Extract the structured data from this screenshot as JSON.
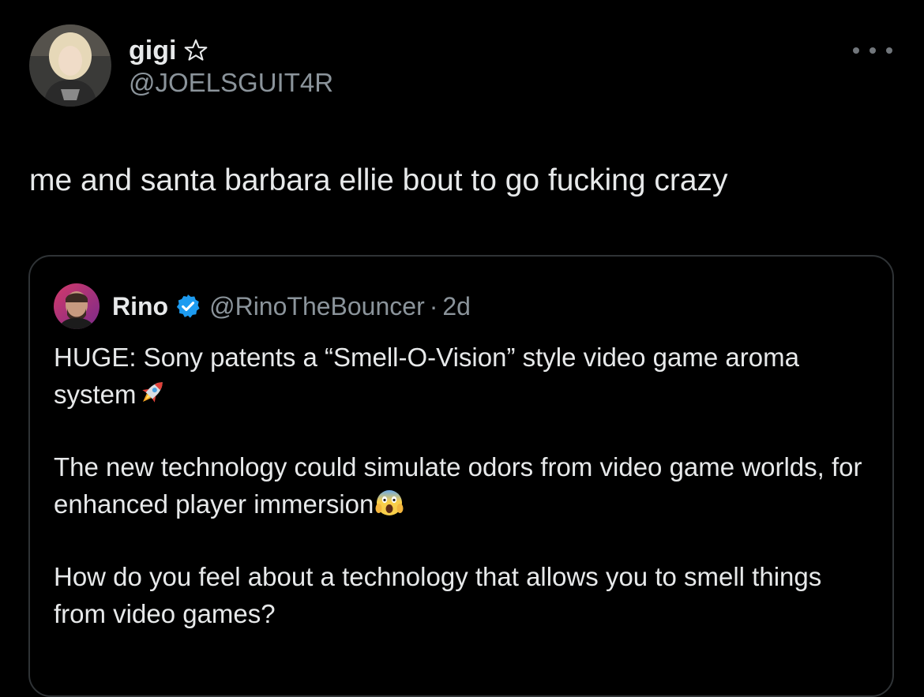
{
  "tweet": {
    "author": {
      "display_name": "gigi",
      "handle": "@JOELSGUIT4R",
      "badge_icon": "star-outline-icon"
    },
    "text": "me and santa barbara ellie bout to go fucking crazy",
    "more_icon": "more-horizontal-icon"
  },
  "quote": {
    "author": {
      "display_name": "Rino",
      "verified_icon": "verified-badge-icon",
      "handle": "@RinoTheBouncer",
      "separator": "·",
      "time": "2d"
    },
    "paragraphs": [
      {
        "text": "HUGE: Sony patents a “Smell-O-Vision” style video game aroma system",
        "emoji": "rocket-emoji"
      },
      {
        "text": "The new technology could simulate odors from video game worlds, for enhanced player immersion",
        "emoji": "screaming-face-emoji"
      },
      {
        "text": "How do you feel about a technology that allows you to smell things from video games?",
        "emoji": ""
      }
    ]
  },
  "colors": {
    "background": "#000000",
    "text_primary": "#e7e9ea",
    "text_secondary": "#8b949b",
    "border": "#2f3336",
    "verified": "#1d9bf0"
  }
}
